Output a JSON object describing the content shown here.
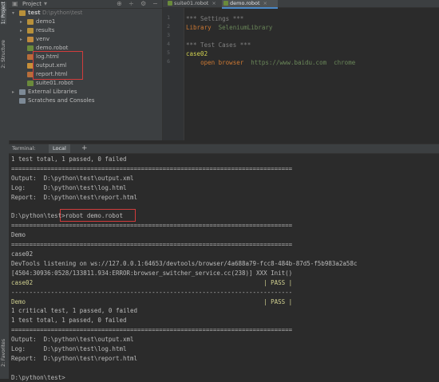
{
  "left_strip": {
    "tabs": [
      "1: Project",
      "2: Structure",
      "2: Favorites"
    ]
  },
  "project_panel": {
    "title": "Project",
    "tree": [
      {
        "label": "test",
        "path": "D:\\python\\test",
        "kind": "folder",
        "depth": 0,
        "expanded": true
      },
      {
        "label": "demo1",
        "kind": "folder",
        "depth": 1,
        "expanded": false
      },
      {
        "label": "results",
        "kind": "folder",
        "depth": 1,
        "expanded": false
      },
      {
        "label": "venv",
        "kind": "folder-orange",
        "depth": 1,
        "expanded": false
      },
      {
        "label": "demo.robot",
        "kind": "robot",
        "depth": 1
      },
      {
        "label": "log.html",
        "kind": "html",
        "depth": 1
      },
      {
        "label": "output.xml",
        "kind": "xml",
        "depth": 1
      },
      {
        "label": "report.html",
        "kind": "html",
        "depth": 1
      },
      {
        "label": "suite01.robot",
        "kind": "robot",
        "depth": 1
      },
      {
        "label": "External Libraries",
        "kind": "lib",
        "depth": 0,
        "expanded": false
      },
      {
        "label": "Scratches and Consoles",
        "kind": "lib",
        "depth": 0
      }
    ]
  },
  "editor": {
    "tabs": [
      {
        "label": "suite01.robot",
        "active": false
      },
      {
        "label": "demo.robot",
        "active": true
      }
    ],
    "line_numbers": [
      "1",
      "2",
      "3",
      "4",
      "5",
      "6"
    ],
    "lines": [
      {
        "parts": [
          {
            "cls": "c-comment",
            "text": "*** Settings ***"
          }
        ]
      },
      {
        "parts": [
          {
            "cls": "c-kw",
            "text": "Library"
          },
          {
            "cls": "c-val",
            "text": "  "
          },
          {
            "cls": "c-str",
            "text": "SeleniumLibrary"
          }
        ]
      },
      {
        "parts": []
      },
      {
        "parts": [
          {
            "cls": "c-comment",
            "text": "*** Test Cases ***"
          }
        ]
      },
      {
        "parts": [
          {
            "cls": "c-tc",
            "text": "case02"
          }
        ]
      },
      {
        "parts": [
          {
            "cls": "c-val",
            "text": "    "
          },
          {
            "cls": "c-kw",
            "text": "open browser"
          },
          {
            "cls": "c-val",
            "text": "  "
          },
          {
            "cls": "c-url",
            "text": "https://www.baidu.com"
          },
          {
            "cls": "c-val",
            "text": "  "
          },
          {
            "cls": "c-url",
            "text": "chrome"
          }
        ]
      }
    ]
  },
  "terminal": {
    "header_label": "Terminal:",
    "tab": "Local",
    "add": "+",
    "lines": [
      "1 test total, 1 passed, 0 failed",
      "==============================================================================",
      "Output:  D:\\python\\test\\output.xml",
      "Log:     D:\\python\\test\\log.html",
      "Report:  D:\\python\\test\\report.html",
      "",
      "D:\\python\\test>robot demo.robot",
      "==============================================================================",
      "Demo",
      "==============================================================================",
      "case02",
      "DevTools listening on ws://127.0.0.1:64653/devtools/browser/4a688a79-fcc8-484b-87d5-f5b983a2a58c",
      "[4504:30936:0528/133811.934:ERROR:browser_switcher_service.cc(238)] XXX Init()",
      "case02                                                                | PASS |",
      "------------------------------------------------------------------------------",
      "Demo                                                                  | PASS |",
      "1 critical test, 1 passed, 0 failed",
      "1 test total, 1 passed, 0 failed",
      "==============================================================================",
      "Output:  D:\\python\\test\\output.xml",
      "Log:     D:\\python\\test\\log.html",
      "Report:  D:\\python\\test\\report.html",
      "",
      "D:\\python\\test>"
    ]
  }
}
